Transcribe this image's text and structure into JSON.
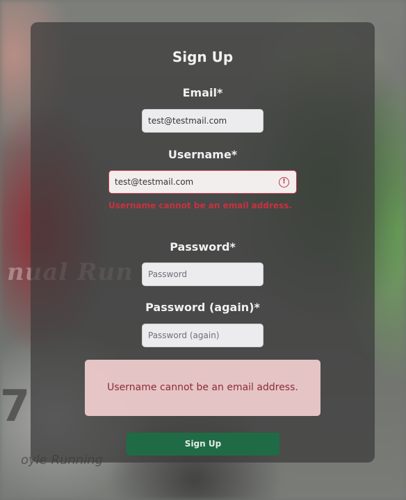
{
  "form": {
    "title": "Sign Up",
    "email": {
      "label": "Email*",
      "value": "test@testmail.com"
    },
    "username": {
      "label": "Username*",
      "value": "test@testmail.com",
      "error_icon": "exclamation-circle-icon",
      "error_text": "Username cannot be an email address."
    },
    "password": {
      "label": "Password*",
      "placeholder": "Password"
    },
    "password_again": {
      "label": "Password (again)*",
      "placeholder": "Password (again)"
    },
    "alert_text": "Username cannot be an email address.",
    "submit_label": "Sign Up"
  },
  "background": {
    "bib_text": "nual Run",
    "bib_number": "7",
    "bib_footer": "oyle Running"
  },
  "colors": {
    "error": "#c8323f",
    "button": "#1f6b45",
    "alert_bg": "#f6d2d4"
  }
}
